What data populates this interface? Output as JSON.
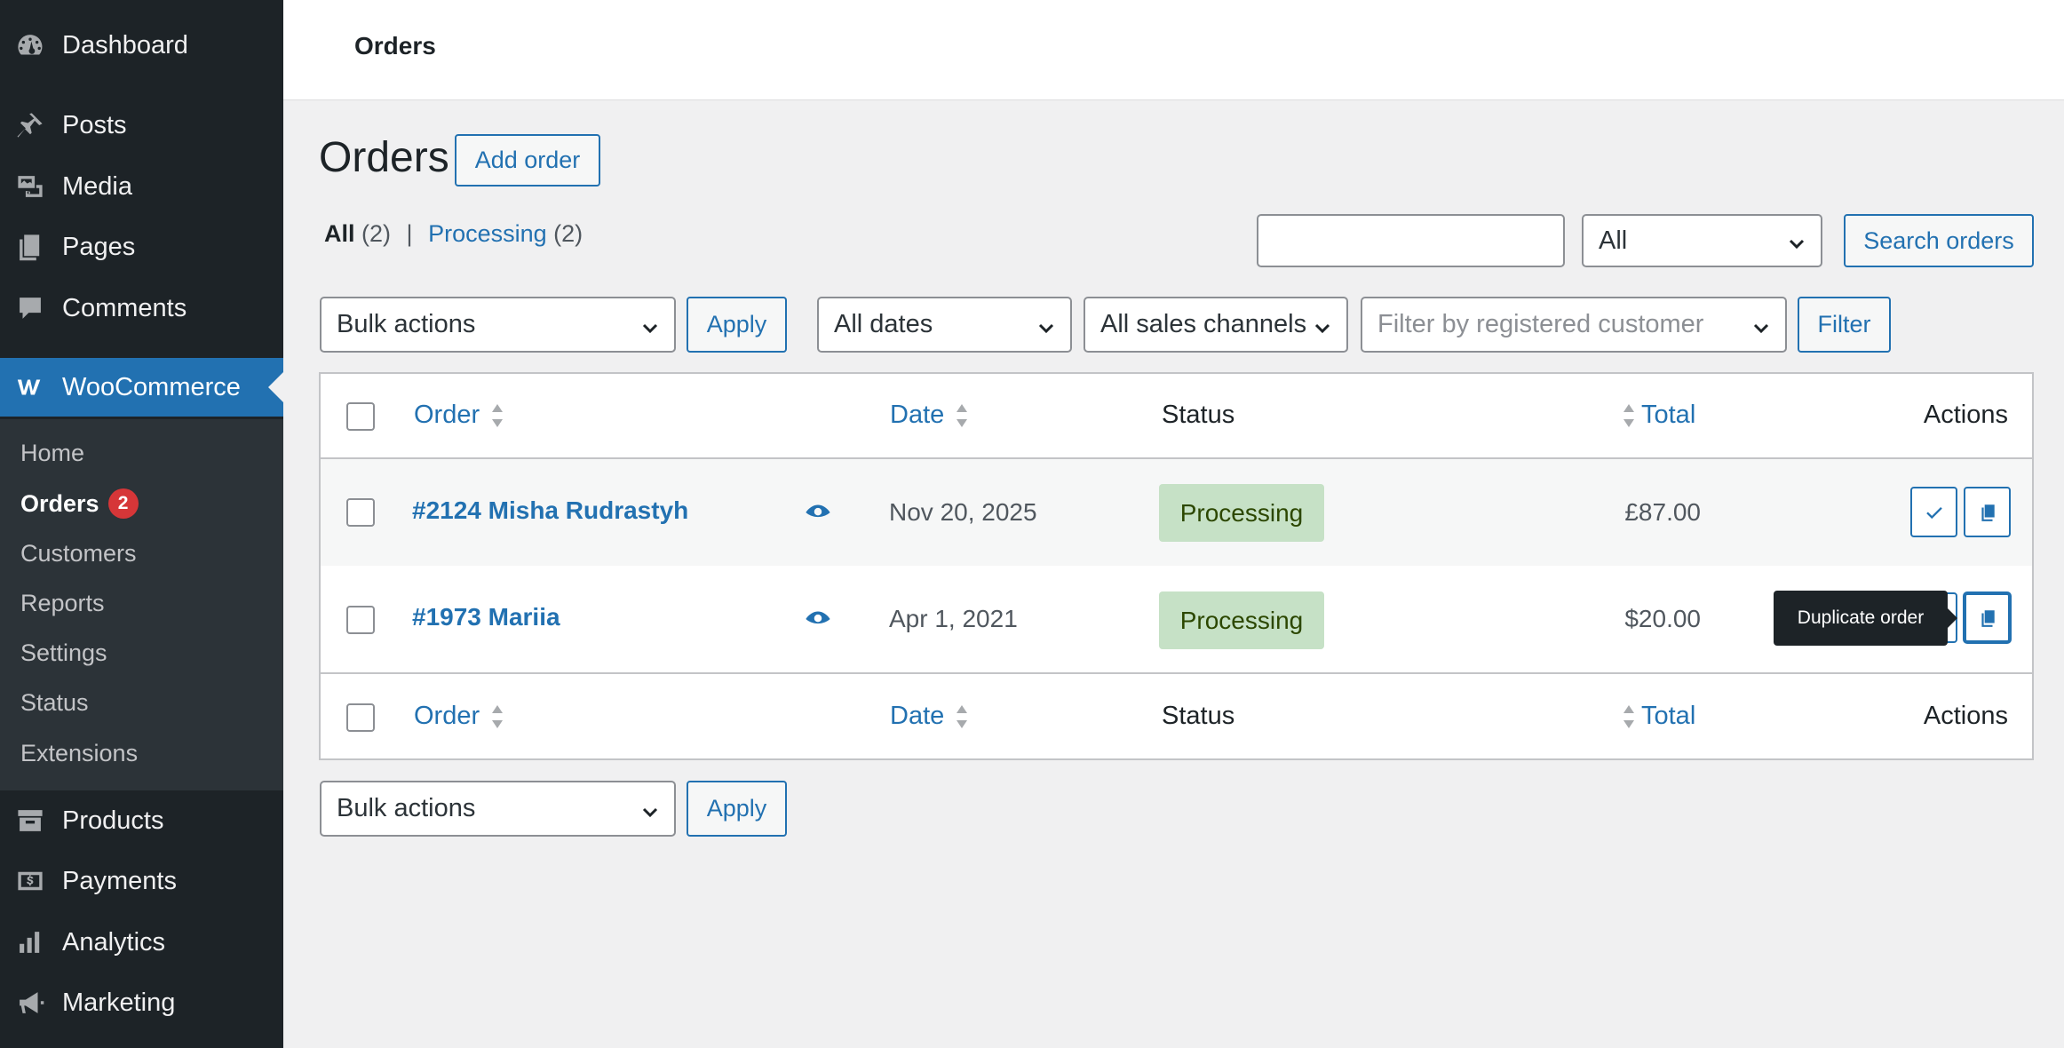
{
  "sidebar": {
    "top_items": [
      {
        "label": "Dashboard",
        "icon": "dashboard-icon"
      },
      {
        "label": "Posts",
        "icon": "pin-icon"
      },
      {
        "label": "Media",
        "icon": "media-icon"
      },
      {
        "label": "Pages",
        "icon": "pages-icon"
      },
      {
        "label": "Comments",
        "icon": "comment-icon"
      }
    ],
    "active": {
      "label": "WooCommerce",
      "icon": "woocommerce-icon"
    },
    "submenu": [
      {
        "label": "Home"
      },
      {
        "label": "Orders",
        "badge": "2"
      },
      {
        "label": "Customers"
      },
      {
        "label": "Reports"
      },
      {
        "label": "Settings"
      },
      {
        "label": "Status"
      },
      {
        "label": "Extensions"
      }
    ],
    "bottom_items": [
      {
        "label": "Products",
        "icon": "archive-icon"
      },
      {
        "label": "Payments",
        "icon": "payments-icon"
      },
      {
        "label": "Analytics",
        "icon": "bar-chart-icon"
      },
      {
        "label": "Marketing",
        "icon": "megaphone-icon"
      }
    ]
  },
  "header": {
    "title": "Orders"
  },
  "page": {
    "title": "Orders",
    "add_button": "Add order"
  },
  "views": {
    "all_label": "All",
    "all_count": "(2)",
    "separator": "|",
    "processing_label": "Processing",
    "processing_count": "(2)"
  },
  "search": {
    "value": "",
    "status_select": "All",
    "button": "Search orders"
  },
  "filters": {
    "bulk_actions": "Bulk actions",
    "apply": "Apply",
    "dates": "All dates",
    "channels": "All sales channels",
    "customer_placeholder": "Filter by registered customer",
    "filter_button": "Filter"
  },
  "table": {
    "columns": {
      "order": "Order",
      "date": "Date",
      "status": "Status",
      "total": "Total",
      "actions": "Actions"
    },
    "rows": [
      {
        "order": "#2124 Misha Rudrastyh",
        "date": "Nov 20, 2025",
        "status": "Processing",
        "total": "£87.00"
      },
      {
        "order": "#1973 Mariia",
        "date": "Apr 1, 2021",
        "status": "Processing",
        "total": "$20.00"
      }
    ]
  },
  "tooltip": {
    "text": "Duplicate order"
  },
  "colors": {
    "accent": "#2271b1",
    "sidebar": "#1d2327",
    "status_processing_bg": "#c6e1c6",
    "badge": "#d63638"
  }
}
